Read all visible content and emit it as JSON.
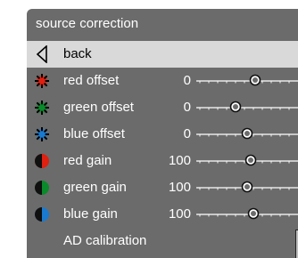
{
  "menu": {
    "title": "source correction",
    "back_label": "back",
    "items": [
      {
        "label": "red offset",
        "value": "0",
        "icon": "red-sun-icon",
        "level": 0.62,
        "color": "#e02010"
      },
      {
        "label": "green offset",
        "value": "0",
        "icon": "green-sun-icon",
        "level": 0.4,
        "color": "#0a8a2a"
      },
      {
        "label": "blue offset",
        "value": "0",
        "icon": "blue-sun-icon",
        "level": 0.53,
        "color": "#1a7ad0"
      },
      {
        "label": "red gain",
        "value": "100",
        "icon": "red-circle-icon",
        "level": 0.57,
        "color": "#e02010"
      },
      {
        "label": "green gain",
        "value": "100",
        "icon": "green-circle-icon",
        "level": 0.53,
        "color": "#0a8a2a"
      },
      {
        "label": "blue gain",
        "value": "100",
        "icon": "blue-circle-icon",
        "level": 0.6,
        "color": "#1a7ad0"
      }
    ],
    "ad_calibration_label": "AD calibration"
  }
}
